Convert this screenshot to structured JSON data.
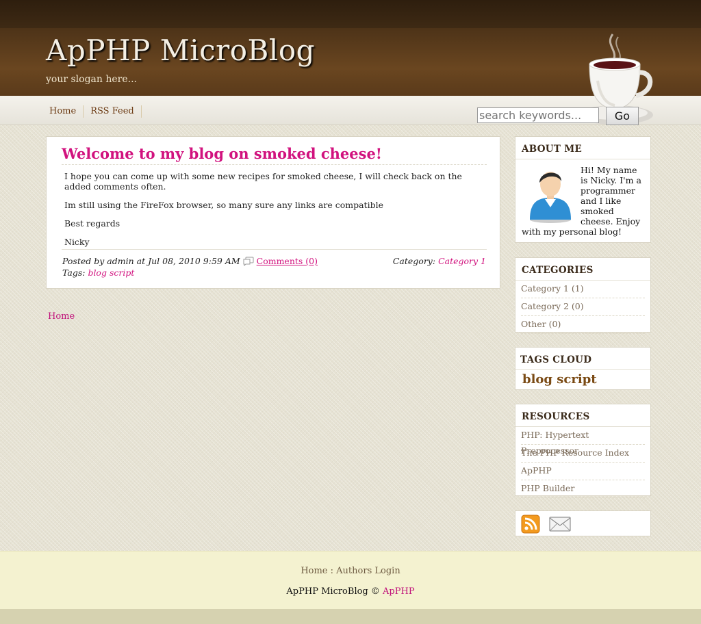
{
  "header": {
    "title": "ApPHP MicroBlog",
    "slogan": "your slogan here...",
    "nav": [
      "Home",
      "RSS Feed"
    ],
    "search_placeholder": "search keywords...",
    "search_button": "Go"
  },
  "post": {
    "title": "Welcome to my blog on smoked cheese!",
    "paragraphs": [
      "I hope you can come up with some new recipes for smoked cheese, I will check back on the added comments often.",
      "Im still using the FireFox browser, so many sure any links are compatible",
      "Best regards",
      "Nicky"
    ],
    "posted_by_prefix": "Posted by",
    "author": "admin",
    "at_word": "at",
    "date": "Jul 08, 2010 9:59 AM",
    "comments_label": "Comments (0)",
    "category_label": "Category:",
    "category_value": "Category 1",
    "tags_label": "Tags:",
    "tags_value": "blog script"
  },
  "breadcrumb": "Home",
  "sidebar": {
    "about": {
      "title": "ABOUT ME",
      "text": "Hi! My name is Nicky. I'm a programmer and I like smoked cheese. Enjoy with my personal blog!"
    },
    "categories": {
      "title": "CATEGORIES",
      "items": [
        "Category 1 (1)",
        "Category 2 (0)",
        "Other (0)"
      ]
    },
    "tags_cloud": {
      "title": "TAGS CLOUD",
      "items": [
        "blog script"
      ]
    },
    "resources": {
      "title": "RESOURCES",
      "items": [
        "PHP: Hypertext Preprocessor",
        "The PHP Resource Index",
        "ApPHP",
        "PHP Builder"
      ]
    }
  },
  "footer": {
    "links": [
      "Home",
      "Authors Login"
    ],
    "separator": ":",
    "copyright_name": "ApPHP MicroBlog",
    "copyright_symbol": "©",
    "copyright_link": "ApPHP"
  },
  "colors": {
    "accent": "#d1127e",
    "header_brown": "#5a3a1a",
    "nav_link": "#6b3a12",
    "footer_bg": "#f4f2d0"
  },
  "icons": [
    "coffee-cup-logo",
    "comment-icon",
    "user-avatar-icon",
    "rss-icon",
    "mail-icon"
  ]
}
